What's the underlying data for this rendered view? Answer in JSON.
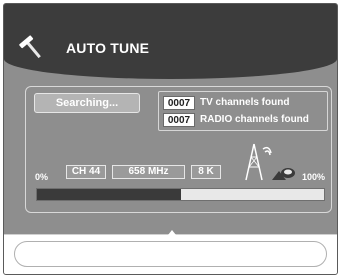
{
  "header": {
    "title": "AUTO TUNE",
    "icon": "hammer-icon"
  },
  "status": {
    "label": "Searching..."
  },
  "found": {
    "tv_count": "0007",
    "tv_label": "TV channels found",
    "radio_count": "0007",
    "radio_label": "RADIO channels found"
  },
  "scan": {
    "start_label": "0%",
    "end_label": "100%",
    "channel": "CH 44",
    "frequency": "658 MHz",
    "bandwidth": "8 K",
    "progress": 0.5
  },
  "icons": [
    "hammer-icon",
    "tower-icon"
  ],
  "colors": {
    "panel": "#8e8e8e",
    "header": "#3c3c3c",
    "fill": "#3a3a3a"
  }
}
